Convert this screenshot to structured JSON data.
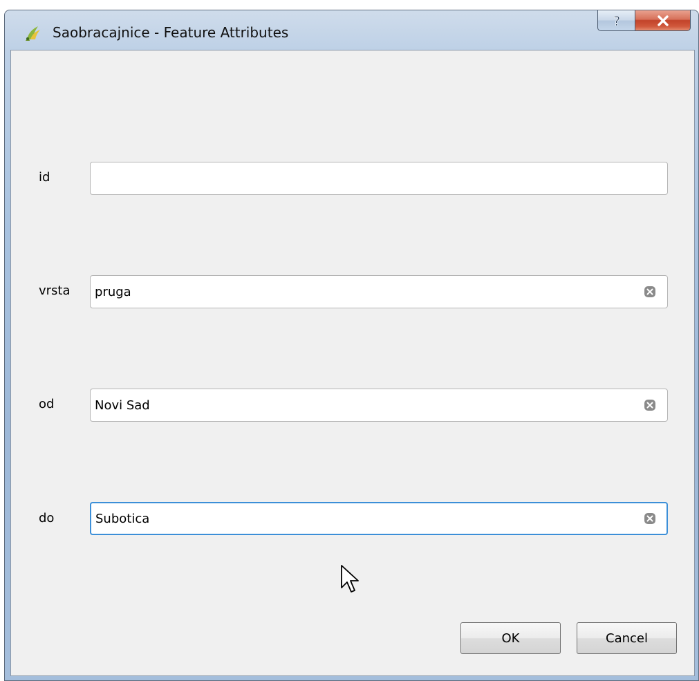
{
  "window": {
    "title": "Saobracajnice - Feature Attributes",
    "help_symbol": "?",
    "close_symbol": "x"
  },
  "fields": [
    {
      "label": "id",
      "value": "",
      "has_clear": false,
      "focused": false
    },
    {
      "label": "vrsta",
      "value": "pruga",
      "has_clear": true,
      "focused": false
    },
    {
      "label": "od",
      "value": "Novi Sad",
      "has_clear": true,
      "focused": false
    },
    {
      "label": "do",
      "value": "Subotica",
      "has_clear": true,
      "focused": true
    }
  ],
  "buttons": {
    "ok_label": "OK",
    "cancel_label": "Cancel"
  },
  "icons": {
    "app": "qgis-logo-icon",
    "help": "help-icon",
    "close": "close-icon",
    "clear": "clear-field-icon",
    "cursor": "mouse-pointer-icon"
  },
  "colors": {
    "focus_border": "#3c8fd8",
    "close_button": "#c2432a"
  }
}
